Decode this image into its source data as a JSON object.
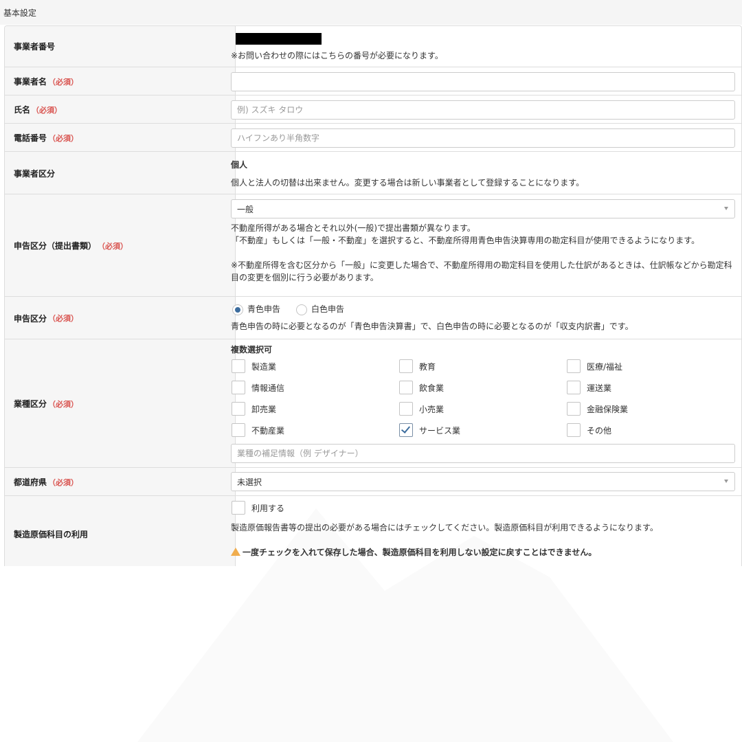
{
  "panel": {
    "title": "基本設定"
  },
  "rows": {
    "business_number": {
      "label": "事業者番号",
      "note": "※お問い合わせの際にはこちらの番号が必要になります。"
    },
    "business_name": {
      "label": "事業者名",
      "required": "（必須）",
      "value": ""
    },
    "full_name": {
      "label": "氏名",
      "required": "（必須）",
      "placeholder": "例) スズキ タロウ"
    },
    "phone": {
      "label": "電話番号",
      "required": "（必須）",
      "placeholder": "ハイフンあり半角数字"
    },
    "business_type": {
      "label": "事業者区分",
      "value": "個人",
      "note": "個人と法人の切替は出来ません。変更する場合は新しい事業者として登録することになります。"
    },
    "filing_category": {
      "label": "申告区分（提出書類）",
      "required": "（必須）",
      "selected": "一般",
      "note1": "不動産所得がある場合とそれ以外(一般)で提出書類が異なります。",
      "note2": "「不動産」もしくは「一般・不動産」を選択すると、不動産所得用青色申告決算専用の勘定科目が使用できるようになります。",
      "note3": "※不動産所得を含む区分から「一般」に変更した場合で、不動産所得用の勘定科目を使用した仕訳があるときは、仕訳帳などから勘定科目の変更を個別に行う必要があります。"
    },
    "return_type": {
      "label": "申告区分",
      "required": "（必須）",
      "options": [
        {
          "label": "青色申告",
          "selected": true
        },
        {
          "label": "白色申告",
          "selected": false
        }
      ],
      "note": "青色申告の時に必要となるのが「青色申告決算書」で、白色申告の時に必要となるのが「収支内訳書」です。"
    },
    "industry": {
      "label": "業種区分",
      "required": "（必須）",
      "heading": "複数選択可",
      "options": [
        {
          "label": "製造業",
          "checked": false
        },
        {
          "label": "教育",
          "checked": false
        },
        {
          "label": "医療/福祉",
          "checked": false
        },
        {
          "label": "情報通信",
          "checked": false
        },
        {
          "label": "飲食業",
          "checked": false
        },
        {
          "label": "運送業",
          "checked": false
        },
        {
          "label": "卸売業",
          "checked": false
        },
        {
          "label": "小売業",
          "checked": false
        },
        {
          "label": "金融保険業",
          "checked": false
        },
        {
          "label": "不動産業",
          "checked": false
        },
        {
          "label": "サービス業",
          "checked": true
        },
        {
          "label": "その他",
          "checked": false
        }
      ],
      "supplement_placeholder": "業種の補足情報（例 デザイナー）"
    },
    "prefecture": {
      "label": "都道府県",
      "required": "（必須）",
      "selected": "未選択"
    },
    "manufacturing_cost": {
      "label": "製造原価科目の利用",
      "checkbox_label": "利用する",
      "checked": false,
      "note": "製造原価報告書等の提出の必要がある場合にはチェックしてください。製造原価科目が利用できるようになります。",
      "warning": "一度チェックを入れて保存した場合、製造原価科目を利用しない設定に戻すことはできません。"
    }
  },
  "icons": {
    "caret": "chevron-down-icon",
    "check": "check-icon",
    "warning": "warning-icon",
    "warning_color": "#f0ad4e",
    "required_color": "#d9534f",
    "radio_color": "#3d6d9e"
  }
}
